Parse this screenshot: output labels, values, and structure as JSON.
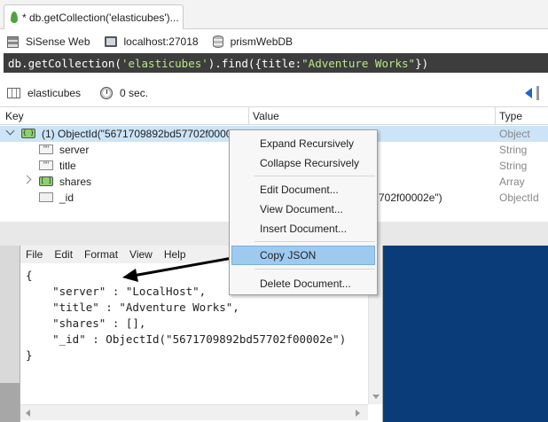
{
  "tab": {
    "title": "* db.getCollection('elasticubes')..."
  },
  "connection": {
    "server": "SiSense Web",
    "host": "localhost:27018",
    "database": "prismWebDB"
  },
  "query": {
    "prefix": "db.getCollection(",
    "collection": "'elasticubes'",
    "middle": ").find({title:",
    "title_value": "\"Adventure Works\"",
    "suffix": "})"
  },
  "results_toolbar": {
    "collection": "elasticubes",
    "time": "0 sec."
  },
  "grid": {
    "columns": {
      "key": "Key",
      "value": "Value",
      "type": "Type"
    },
    "root": {
      "key": "(1) ObjectId(\"5671709892bd57702f00002e",
      "type": "Object"
    },
    "rows": [
      {
        "key": "server",
        "value": "",
        "type": "String"
      },
      {
        "key": "title",
        "value": "",
        "type": "String"
      },
      {
        "key": "shares",
        "value": "",
        "type": "Array"
      },
      {
        "key": "_id",
        "value": "702f00002e\")",
        "type": "ObjectId"
      }
    ]
  },
  "context_menu": {
    "expand": "Expand Recursively",
    "collapse": "Collapse Recursively",
    "edit": "Edit Document...",
    "view": "View Document...",
    "insert": "Insert Document...",
    "copy_json": "Copy JSON",
    "delete": "Delete Document..."
  },
  "notepad": {
    "menu": [
      "File",
      "Edit",
      "Format",
      "View",
      "Help"
    ],
    "content": "{\n    \"server\" : \"LocalHost\",\n    \"title\" : \"Adventure Works\",\n    \"shares\" : [],\n    \"_id\" : ObjectId(\"5671709892bd57702f00002e\")\n}"
  },
  "icons": {
    "tab": "mongodb-leaf-icon",
    "server": "server-icon",
    "host": "monitor-icon",
    "database": "database-icon",
    "results": "grid-icon",
    "time": "clock-icon"
  },
  "colors": {
    "query_bg": "#3d3d3d",
    "query_string": "#b7e88b",
    "selection": "#cce4f7",
    "menu_highlight": "#9fcaf0",
    "desktop": "#0b3c7a"
  }
}
